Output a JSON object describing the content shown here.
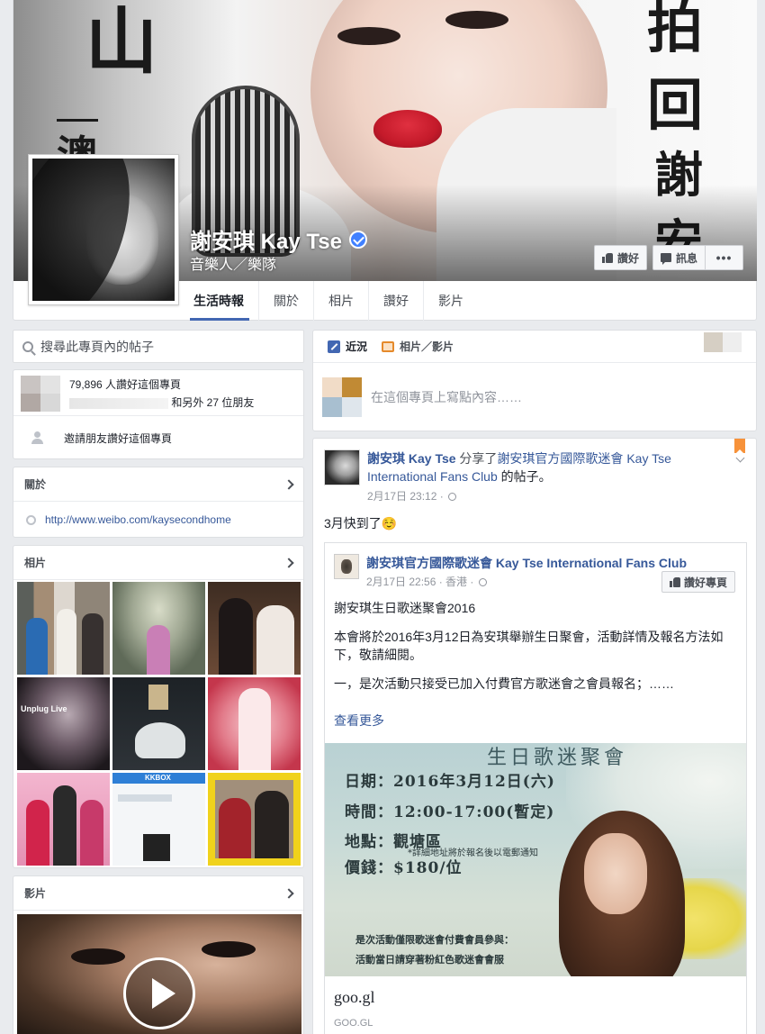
{
  "page": {
    "name": "謝安琪 Kay Tse",
    "category": "音樂人／樂隊",
    "cover_text": {
      "left_top": "山",
      "left_mid": "澳",
      "right_1": "拍",
      "right_2": "回",
      "right_3": "謝",
      "right_4": "安"
    }
  },
  "header_buttons": {
    "like": "讚好",
    "message": "訊息",
    "more": "•••"
  },
  "tabs": [
    {
      "label": "生活時報"
    },
    {
      "label": "關於"
    },
    {
      "label": "相片"
    },
    {
      "label": "讚好"
    },
    {
      "label": "影片"
    }
  ],
  "search": {
    "placeholder": "搜尋此專頁內的帖子"
  },
  "likes": {
    "count_text": "79,896 人讚好這個專頁",
    "friends_text": "和另外 27 位朋友",
    "invite": "邀請朋友讚好這個專頁"
  },
  "about": {
    "header": "關於",
    "link": "http://www.weibo.com/kaysecondhome"
  },
  "photos": {
    "header": "相片"
  },
  "videos": {
    "header": "影片"
  },
  "composer": {
    "tab_status": "近況",
    "tab_photo": "相片／影片",
    "placeholder": "在這個專頁上寫點內容……"
  },
  "post": {
    "author": "謝安琪 Kay Tse",
    "shared_verb": " 分享了",
    "shared_page": "謝安琪官方國際歌迷會 Kay Tse International Fans Club",
    "shared_suffix": " 的帖子。",
    "time": "2月17日 23:12 ·",
    "text": "3月快到了☺️",
    "shared": {
      "page": "謝安琪官方國際歌迷會 Kay Tse International Fans Club",
      "time": "2月17日 22:56 · 香港 ·",
      "like_page": "讚好專頁",
      "line1": "謝安琪生日歌迷聚會2016",
      "line2": "本會將於2016年3月12日為安琪舉辦生日聚會，活動詳情及報名方法如下，敬請細閱。",
      "line3": "一，是次活動只接受已加入付費官方歌迷會之會員報名；……",
      "see_more": "查看更多",
      "poster": {
        "title": "生日歌迷聚會",
        "date": "日期：2016年3月12日(六)",
        "time": "時間：12:00-17:00(暫定)",
        "place": "地點：觀塘區",
        "note": "*詳細地址將於報名後以電郵通知",
        "price": "價錢：$180/位",
        "foot1": "是次活動僅限歌迷會付費會員參與：",
        "foot2": "活動當日請穿著粉紅色歌迷會會服"
      },
      "link_title": "goo.gl",
      "link_domain": "GOO.GL"
    }
  },
  "colors": {
    "fb_blue": "#4267b2",
    "link": "#365899",
    "background": "#e9ebee",
    "verified": "#4080ff"
  }
}
